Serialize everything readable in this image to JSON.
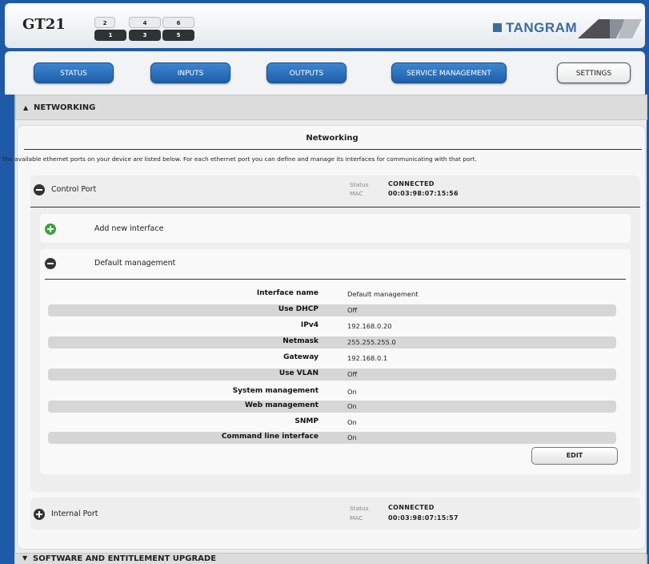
{
  "header": {
    "model": "GT21",
    "ports_top": [
      "2",
      "4",
      "6"
    ],
    "ports_bottom": [
      "1",
      "3",
      "5"
    ],
    "brand": "TANGRAM"
  },
  "nav": {
    "tabs": [
      {
        "label": "STATUS"
      },
      {
        "label": "INPUTS"
      },
      {
        "label": "OUTPUTS"
      },
      {
        "label": "SERVICE MANAGEMENT"
      },
      {
        "label": "SETTINGS",
        "active": true
      }
    ]
  },
  "networking": {
    "section_label": "NETWORKING",
    "title": "Networking",
    "description": "The available ethernet ports on your device are listed below. For each ethernet port you can define and manage its interfaces for communicating with that port.",
    "control_port": {
      "label": "Control Port",
      "status_label": "Status",
      "status": "CONNECTED",
      "mac_label": "MAC",
      "mac": "00:03:98:07:15:56"
    },
    "add_interface": "Add new interface",
    "default_interface": {
      "label": "Default management",
      "rows": [
        {
          "label": "Interface name",
          "value": "Default management"
        },
        {
          "label": "Use DHCP",
          "value": "Off"
        },
        {
          "label": "IPv4",
          "value": "192.168.0.20"
        },
        {
          "label": "Netmask",
          "value": "255.255.255.0"
        },
        {
          "label": "Gateway",
          "value": "192.168.0.1"
        },
        {
          "label": "Use VLAN",
          "value": "Off"
        },
        {
          "label": "System management",
          "value": "On"
        },
        {
          "label": "Web management",
          "value": "On"
        },
        {
          "label": "SNMP",
          "value": "On"
        },
        {
          "label": "Command line interface",
          "value": "On"
        }
      ],
      "edit_label": "EDIT"
    },
    "internal_port": {
      "label": "Internal Port",
      "status_label": "Status",
      "status": "CONNECTED",
      "mac_label": "MAC",
      "mac": "00:03:98:07:15:57"
    }
  },
  "upgrade": {
    "section_label": "SOFTWARE AND ENTITLEMENT UPGRADE"
  },
  "colors": {
    "frame": "#1f5aa8",
    "nav_button": "#2a6fbd",
    "brand": "#3a6d9e",
    "add_icon": "#3aa13a"
  }
}
